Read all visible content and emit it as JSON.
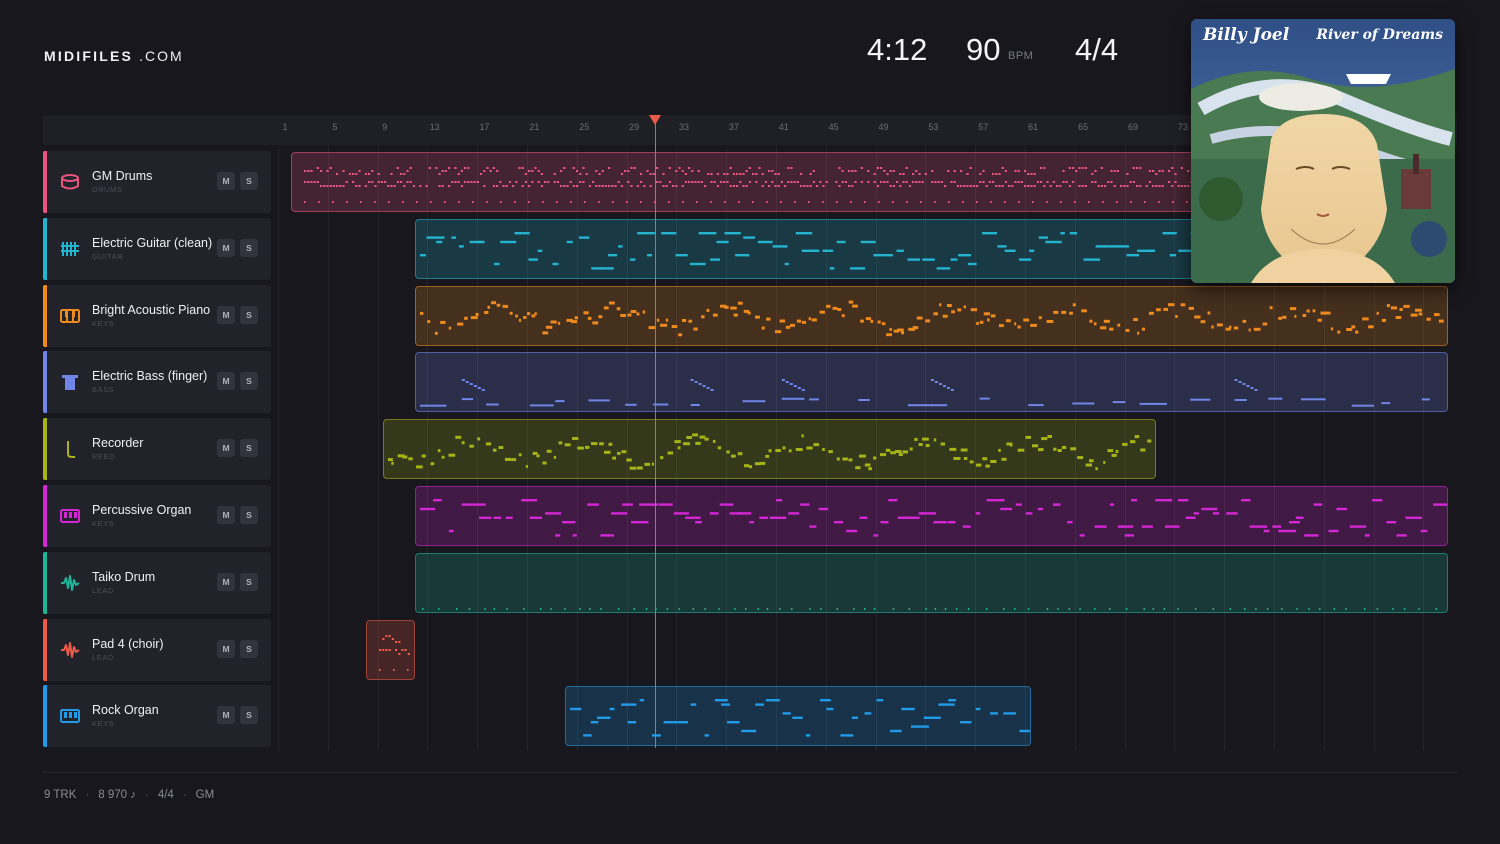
{
  "brand": {
    "name_bold": "MIDIFILES",
    "name_suffix": ".COM"
  },
  "transport": {
    "time": "4:12",
    "bpm": "90",
    "bpm_unit": "BPM",
    "time_signature": "4/4"
  },
  "ruler": {
    "ticks": [
      "1",
      "5",
      "9",
      "13",
      "17",
      "21",
      "25",
      "29",
      "33",
      "37",
      "41",
      "45",
      "49",
      "53",
      "57",
      "61",
      "65",
      "69",
      "73"
    ]
  },
  "album": {
    "artist": "Billy Joel",
    "title": "River of Dreams"
  },
  "tracks": [
    {
      "name": "GM Drums",
      "category": "DRUMS",
      "color": "#e9557f",
      "icon": "drum-icon",
      "mute": "M",
      "solo": "S"
    },
    {
      "name": "Electric Guitar (clean)",
      "category": "GUITAR",
      "color": "#25b4d0",
      "icon": "guitar-icon",
      "mute": "M",
      "solo": "S"
    },
    {
      "name": "Bright Acoustic Piano",
      "category": "KEYS",
      "color": "#ee8a1e",
      "icon": "piano-icon",
      "mute": "M",
      "solo": "S"
    },
    {
      "name": "Electric Bass (finger)",
      "category": "BASS",
      "color": "#7085e6",
      "icon": "bass-icon",
      "mute": "M",
      "solo": "S"
    },
    {
      "name": "Recorder",
      "category": "REED",
      "color": "#a6b418",
      "icon": "reed-icon",
      "mute": "M",
      "solo": "S"
    },
    {
      "name": "Percussive Organ",
      "category": "KEYS",
      "color": "#d526d6",
      "icon": "organ-icon",
      "mute": "M",
      "solo": "S"
    },
    {
      "name": "Taiko Drum",
      "category": "LEAD",
      "color": "#1fb496",
      "icon": "wave-icon",
      "mute": "M",
      "solo": "S"
    },
    {
      "name": "Pad 4 (choir)",
      "category": "LEAD",
      "color": "#ec5a48",
      "icon": "wave-icon",
      "mute": "M",
      "solo": "S"
    },
    {
      "name": "Rock Organ",
      "category": "KEYS",
      "color": "#219be8",
      "icon": "organ-icon",
      "mute": "M",
      "solo": "S"
    }
  ],
  "footer": {
    "tracks": "9 TRK",
    "notes": "8 970 ♪",
    "signature": "4/4",
    "standard": "GM"
  }
}
